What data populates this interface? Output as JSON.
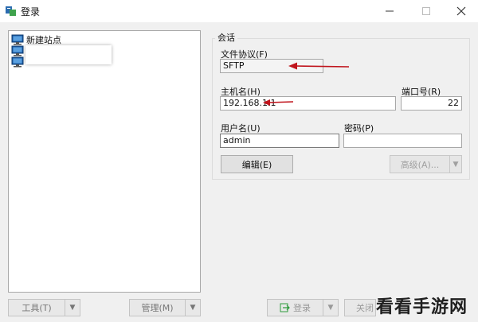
{
  "window": {
    "title": "登录"
  },
  "tree": {
    "items": [
      {
        "label": "新建站点"
      },
      {
        "label": ""
      },
      {
        "label": ""
      }
    ]
  },
  "session": {
    "group_title": "会话",
    "protocol": {
      "label": "文件协议(F)",
      "value": "SFTP"
    },
    "host": {
      "label": "主机名(H)",
      "value": "192.168.1.1"
    },
    "port": {
      "label": "端口号(R)",
      "value": "22"
    },
    "user": {
      "label": "用户名(U)",
      "value": "admin"
    },
    "password": {
      "label": "密码(P)",
      "value": ""
    },
    "edit_label": "编辑(E)",
    "advanced_label": "高级(A)..."
  },
  "bottom": {
    "tools_label": "工具(T)",
    "manage_label": "管理(M)",
    "login_label": "登录",
    "close_label": "关闭"
  },
  "watermark": "看看手游网",
  "colors": {
    "annotation_arrow": "#c0141c",
    "login_icon": "#2e9b3c"
  }
}
